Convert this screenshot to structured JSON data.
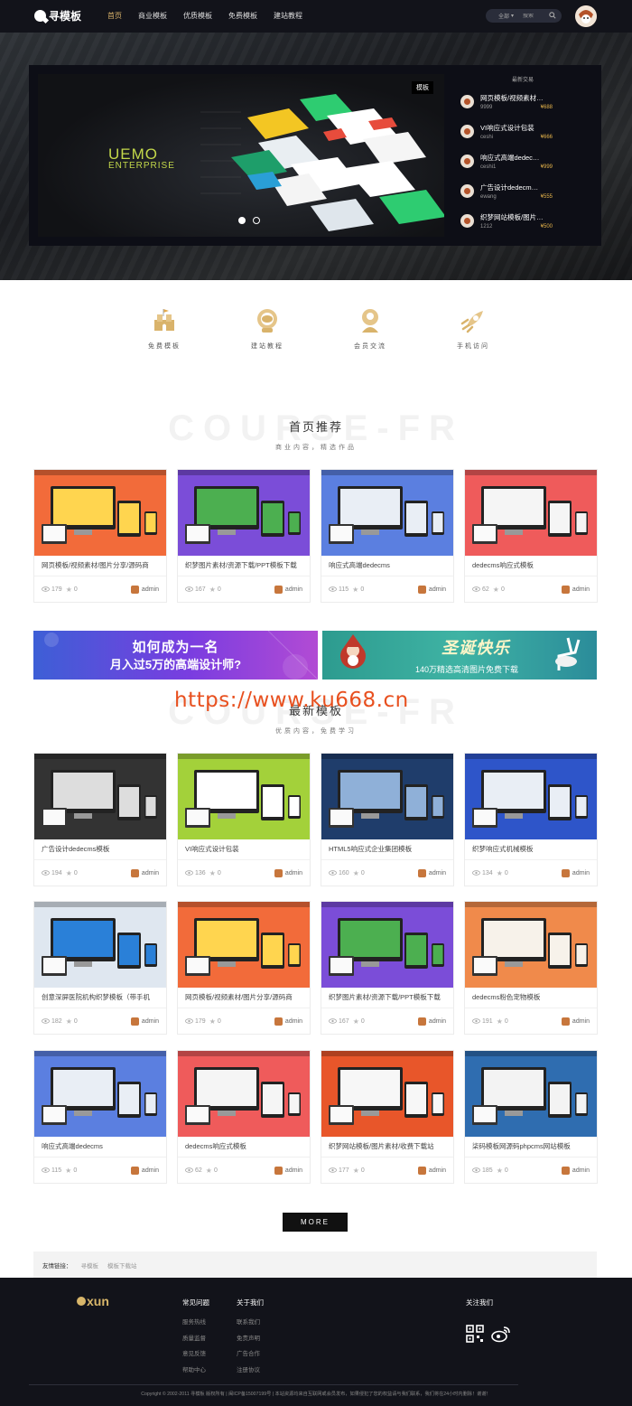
{
  "header": {
    "logo_text": "寻模板",
    "nav": [
      "首页",
      "商业模板",
      "优质模板",
      "免费模板",
      "建站教程"
    ],
    "active_nav": "首页",
    "search_scope": "全部",
    "search_placeholder": "搜索"
  },
  "hero": {
    "banner_tag": "模板",
    "brand_line1": "UEMO",
    "brand_line2": "ENTERPRISE",
    "latest_title": "最新交易",
    "latest": [
      {
        "title": "网页模板/视频素材…",
        "user": "9999",
        "price": "¥688"
      },
      {
        "title": "VI响应式设计包装",
        "user": "ceshi",
        "price": "¥666"
      },
      {
        "title": "响应式高端dedec…",
        "user": "ceshi1",
        "price": "¥999"
      },
      {
        "title": "广告设计dedecm…",
        "user": "ewang",
        "price": "¥555"
      },
      {
        "title": "织梦网站模板/图片…",
        "user": "1212",
        "price": "¥500"
      }
    ]
  },
  "features": [
    {
      "label": "免费模板",
      "icon": "castle-icon"
    },
    {
      "label": "建站教程",
      "icon": "astronaut-icon"
    },
    {
      "label": "会员交流",
      "icon": "member-icon"
    },
    {
      "label": "手机访问",
      "icon": "rocket-icon"
    }
  ],
  "recommend": {
    "bg_text": "COURSE-FR",
    "title": "首页推荐",
    "subtitle": "商业内容，精选作品",
    "cards": [
      {
        "title": "网页模板/视频素材/图片分享/源码商",
        "views": "179",
        "stars": "0",
        "author": "admin"
      },
      {
        "title": "织梦图片素材/资源下载/PPT模板下载",
        "views": "167",
        "stars": "0",
        "author": "admin"
      },
      {
        "title": "响应式高端dedecms",
        "views": "115",
        "stars": "0",
        "author": "admin"
      },
      {
        "title": "dedecms响应式模板",
        "views": "62",
        "stars": "0",
        "author": "admin"
      }
    ]
  },
  "ads": {
    "ad1_line1": "如何成为一名",
    "ad1_line2": "月入过5万的高端设计师?",
    "ad2_line1": "圣诞快乐",
    "ad2_line2": "140万精选高清图片免费下载"
  },
  "watermark": "https://www.ku668.cn",
  "latest_section": {
    "bg_text": "COURSE-FR",
    "title": "最新模板",
    "subtitle": "优质内容，免费学习",
    "cards": [
      {
        "title": "广告设计dedecms模板",
        "views": "194",
        "stars": "0",
        "author": "admin"
      },
      {
        "title": "VI响应式设计包装",
        "views": "136",
        "stars": "0",
        "author": "admin"
      },
      {
        "title": "HTML5响应式企业集团模板",
        "views": "160",
        "stars": "0",
        "author": "admin"
      },
      {
        "title": "织梦响应式机械模板",
        "views": "134",
        "stars": "0",
        "author": "admin"
      },
      {
        "title": "创意深屏医院机构织梦模板（带手机",
        "views": "182",
        "stars": "0",
        "author": "admin"
      },
      {
        "title": "网页模板/视频素材/图片分享/源码商",
        "views": "179",
        "stars": "0",
        "author": "admin"
      },
      {
        "title": "织梦图片素材/资源下载/PPT模板下载",
        "views": "167",
        "stars": "0",
        "author": "admin"
      },
      {
        "title": "dedecms粉色宠物模板",
        "views": "191",
        "stars": "0",
        "author": "admin"
      },
      {
        "title": "响应式高端dedecms",
        "views": "115",
        "stars": "0",
        "author": "admin"
      },
      {
        "title": "dedecms响应式模板",
        "views": "62",
        "stars": "0",
        "author": "admin"
      },
      {
        "title": "织梦网站模板/图片素材/收费下载站",
        "views": "177",
        "stars": "0",
        "author": "admin"
      },
      {
        "title": "柒码模板网源码phpcms网站模板",
        "views": "185",
        "stars": "0",
        "author": "admin"
      }
    ]
  },
  "more_label": "MORE",
  "friend_links": {
    "label": "友情链接：",
    "items": [
      "寻模板",
      "模板下载站"
    ]
  },
  "footer": {
    "logo": "xun",
    "col1_title": "常见问题",
    "col1": [
      "服务热线",
      "质量监督",
      "意见反馈",
      "帮助中心"
    ],
    "col2_title": "关于我们",
    "col2": [
      "联系我们",
      "免责声明",
      "广告合作",
      "注册协议"
    ],
    "follow_title": "关注我们",
    "copyright": "Copyright © 2002-2011 寻模板 版权所有 | 闽ICP备15007199号 | 本站资源均来自互联网或会员发布，如果侵犯了您的权益请与我们联系，我们将在24小时内删除！谢谢！"
  },
  "colors": {
    "header_bg": "#12131a",
    "accent_gold": "#d9b36b",
    "price": "#e6b44a",
    "watermark": "#e8501f"
  }
}
